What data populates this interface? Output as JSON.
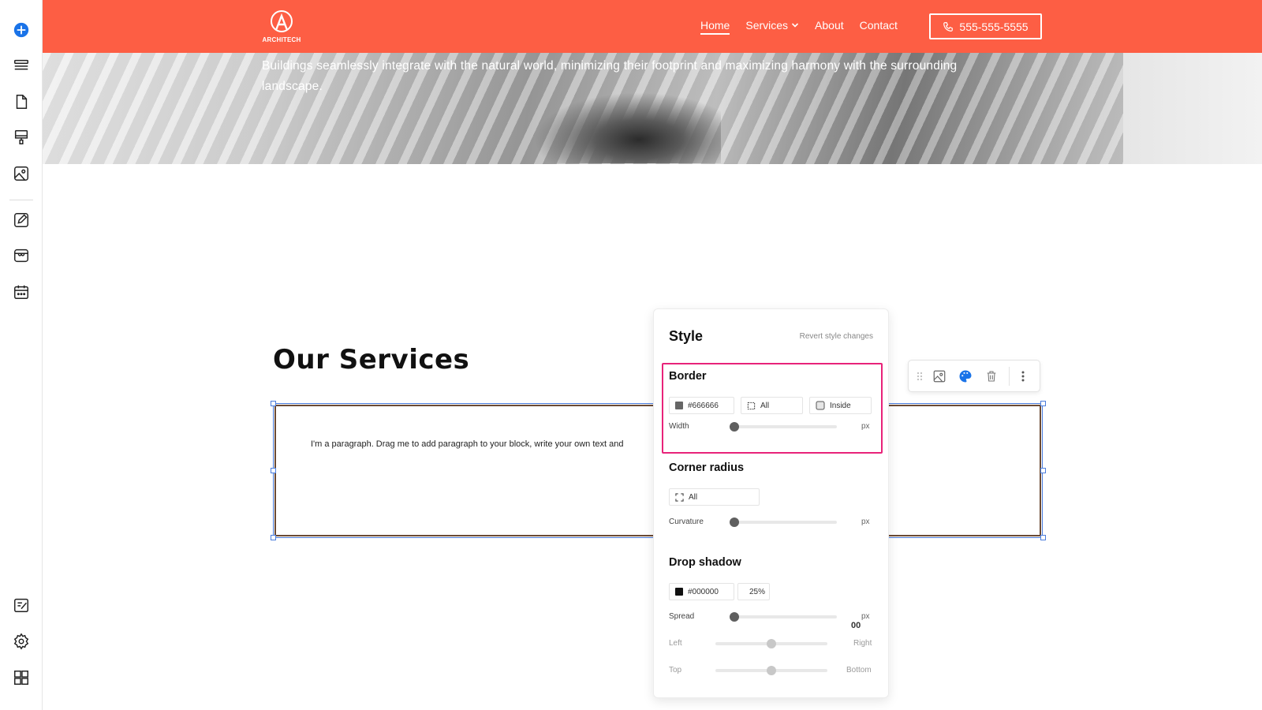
{
  "sidebar": {
    "icons": [
      "add-icon",
      "layers-icon",
      "page-icon",
      "paint-roller-icon",
      "image-icon",
      "edit-icon",
      "store-icon",
      "calendar-icon",
      "site-design-icon",
      "settings-icon",
      "apps-icon"
    ]
  },
  "header": {
    "brand": "ARCHITECH",
    "nav": [
      {
        "label": "Home",
        "active": true
      },
      {
        "label": "Services",
        "dropdown": true
      },
      {
        "label": "About"
      },
      {
        "label": "Contact"
      }
    ],
    "phone": "555-555-5555",
    "accent_color": "#fd5e44"
  },
  "hero": {
    "text": "Buildings seamlessly integrate with the natural world, minimizing their footprint and maximizing harmony with the surrounding landscape."
  },
  "content": {
    "services_title": "Our Services",
    "paragraph": "I'm a paragraph. Drag me to add paragraph to your block, write your own text and"
  },
  "toolbar": {
    "icons": [
      "drag-handle-icon",
      "image-icon",
      "palette-icon",
      "trash-icon",
      "more-icon"
    ]
  },
  "style_panel": {
    "title": "Style",
    "revert": "Revert style changes",
    "border": {
      "heading": "Border",
      "color": "#666666",
      "sides": "All",
      "position": "Inside",
      "width_label": "Width",
      "unit": "px",
      "width_value": 0
    },
    "corner_radius": {
      "heading": "Corner radius",
      "corners": "All",
      "curvature_label": "Curvature",
      "unit": "px",
      "curvature_value": 0
    },
    "drop_shadow": {
      "heading": "Drop shadow",
      "color": "#000000",
      "opacity": "25%",
      "spread_label": "Spread",
      "spread_value": "00",
      "unit": "px",
      "left_label": "Left",
      "right_label": "Right",
      "top_label": "Top",
      "bottom_label": "Bottom",
      "horizontal_value": 0.5,
      "vertical_value": 0.5
    },
    "highlight_color": "#e8237a"
  }
}
